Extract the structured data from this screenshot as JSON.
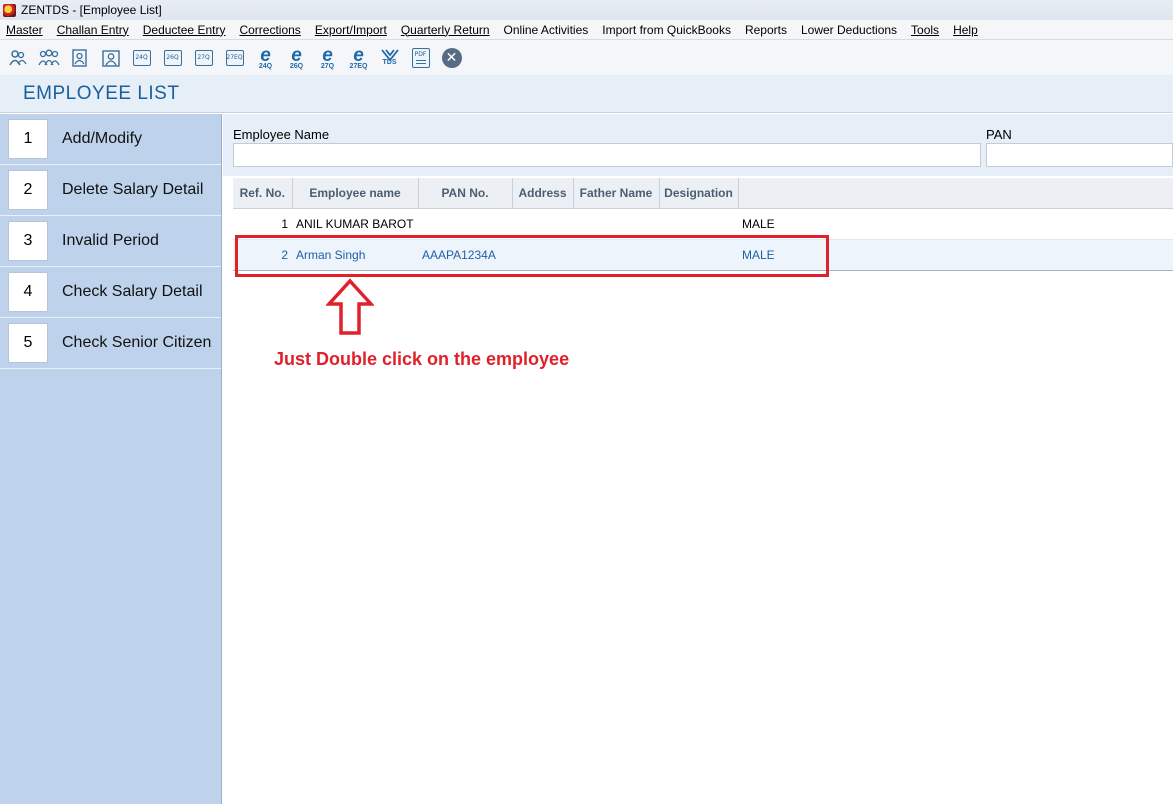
{
  "window": {
    "title": "ZENTDS - [Employee List]"
  },
  "menu": [
    {
      "label": "Master"
    },
    {
      "label": "Challan Entry"
    },
    {
      "label": "Deductee Entry"
    },
    {
      "label": "Corrections"
    },
    {
      "label": "Export/Import"
    },
    {
      "label": "Quarterly Return"
    },
    {
      "label": "Online Activities"
    },
    {
      "label": "Import from QuickBooks"
    },
    {
      "label": "Reports"
    },
    {
      "label": "Lower Deductions"
    },
    {
      "label": "Tools"
    },
    {
      "label": "Help"
    }
  ],
  "toolbar": {
    "forms": [
      "24Q",
      "26Q",
      "27Q",
      "27EQ"
    ],
    "e_forms": [
      "24Q",
      "26Q",
      "27Q",
      "27EQ"
    ],
    "tds_label": "TDS",
    "pdf_label": "PDF"
  },
  "page": {
    "heading": "EMPLOYEE LIST"
  },
  "sidebar": {
    "items": [
      {
        "num": "1",
        "label": "Add/Modify"
      },
      {
        "num": "2",
        "label": "Delete Salary Detail"
      },
      {
        "num": "3",
        "label": "Invalid Period"
      },
      {
        "num": "4",
        "label": "Check Salary Detail"
      },
      {
        "num": "5",
        "label": "Check Senior Citizen"
      }
    ]
  },
  "filters": {
    "employee_name_label": "Employee Name",
    "employee_name_value": "",
    "pan_label": "PAN",
    "pan_value": ""
  },
  "table": {
    "columns": [
      "Ref. No.",
      "Employee name",
      "PAN No.",
      "Address",
      "Father Name",
      "Designation"
    ],
    "rows": [
      {
        "ref": "1",
        "name": "ANIL KUMAR BAROT",
        "pan": "",
        "address": "",
        "father": "",
        "designation": "",
        "gender": "MALE",
        "selected": false
      },
      {
        "ref": "2",
        "name": "Arman Singh",
        "pan": "AAAPA1234A",
        "address": "",
        "father": "",
        "designation": "",
        "gender": "MALE",
        "selected": true
      }
    ]
  },
  "annotation": {
    "text": "Just Double click on the employee",
    "color": "#e0202a"
  }
}
